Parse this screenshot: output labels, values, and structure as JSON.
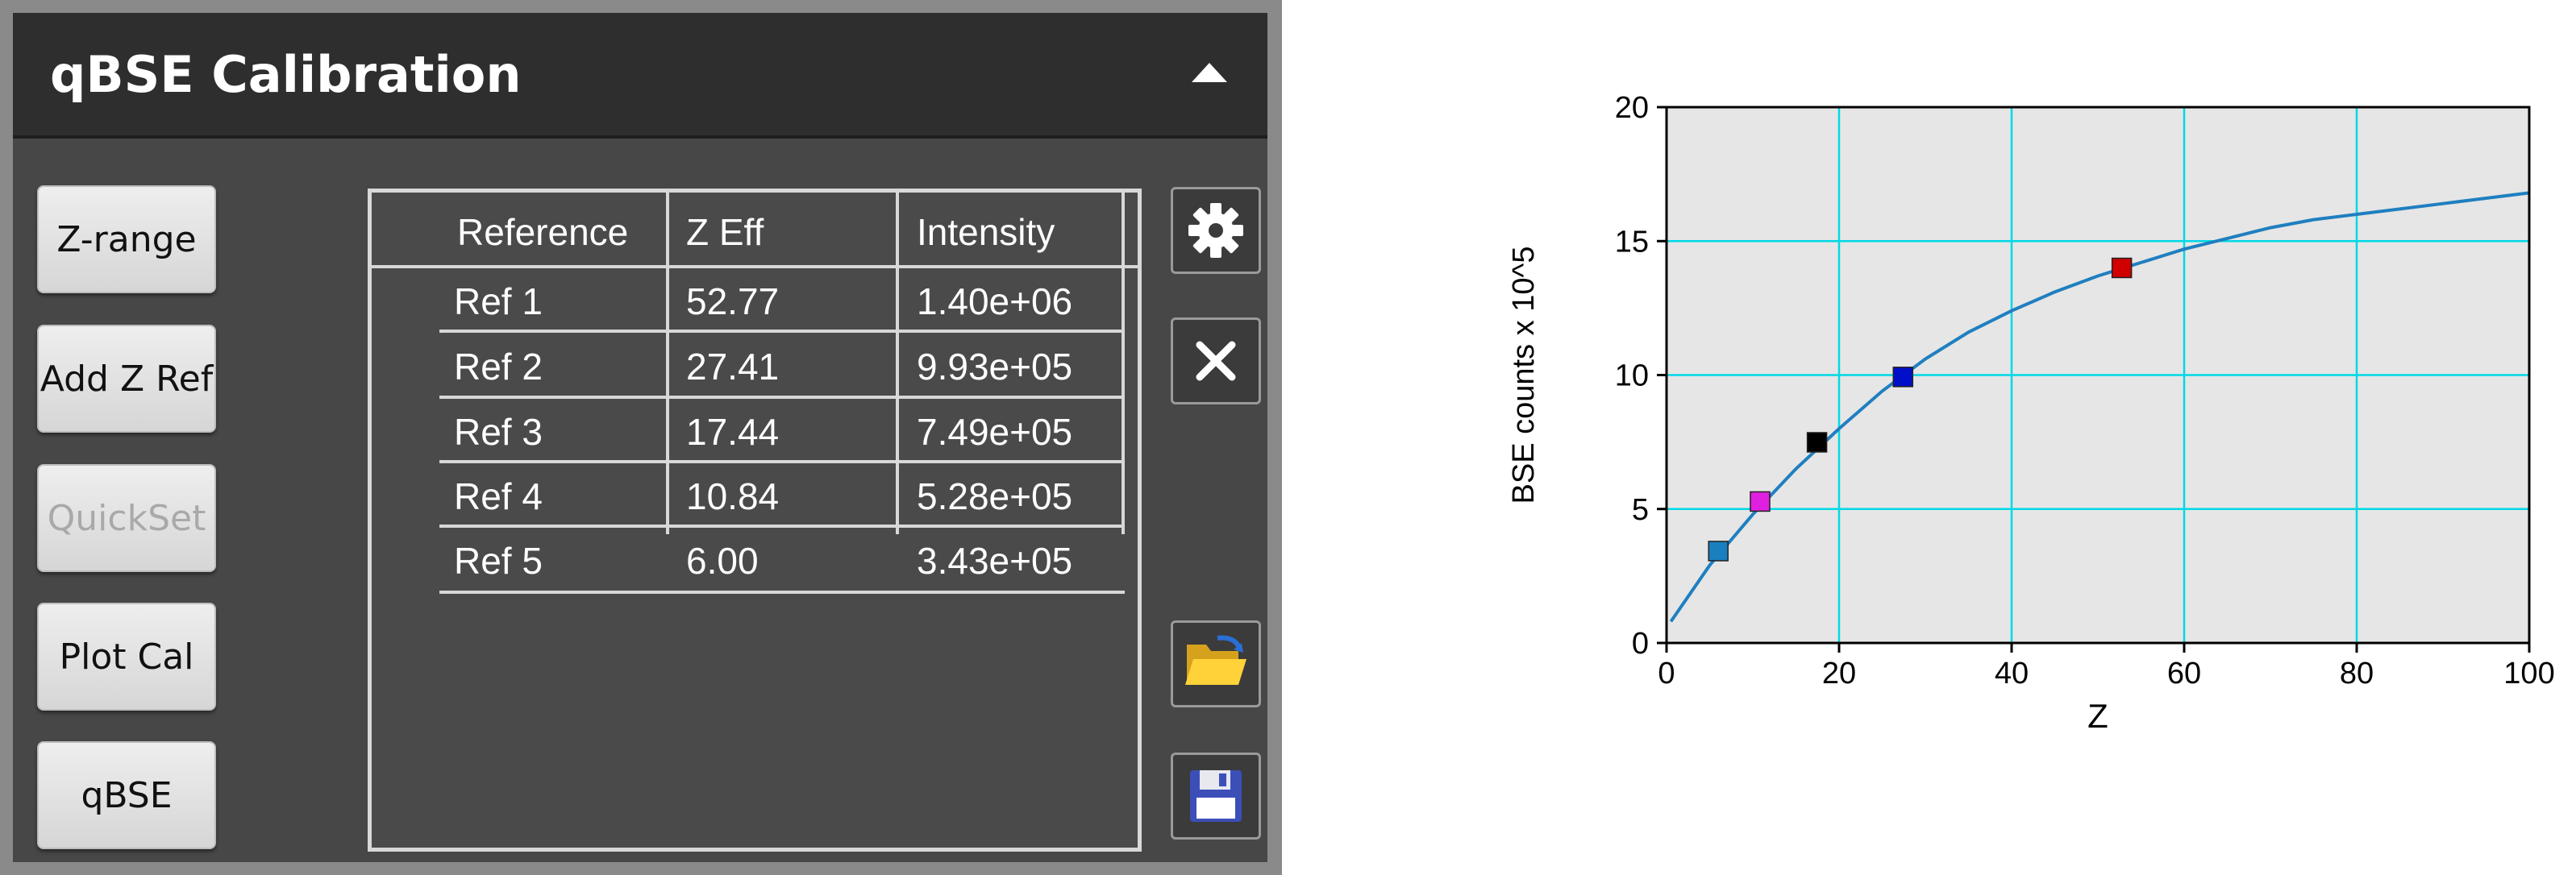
{
  "panel": {
    "title": "qBSE Calibration",
    "buttons": [
      {
        "label": "Z-range",
        "enabled": true
      },
      {
        "label": "Add Z Ref",
        "enabled": true
      },
      {
        "label": "QuickSet",
        "enabled": false
      },
      {
        "label": "Plot Cal",
        "enabled": true
      },
      {
        "label": "qBSE",
        "enabled": true
      }
    ],
    "table": {
      "headers": [
        "Reference",
        "Z Eff",
        "Intensity"
      ],
      "rows": [
        [
          "Ref 1",
          "52.77",
          "1.40e+06"
        ],
        [
          "Ref 2",
          "27.41",
          "9.93e+05"
        ],
        [
          "Ref 3",
          "17.44",
          "7.49e+05"
        ],
        [
          "Ref 4",
          "10.84",
          "5.28e+05"
        ],
        [
          "Ref 5",
          "6.00",
          "3.43e+05"
        ]
      ]
    },
    "icons": [
      "gear-icon",
      "close-icon",
      "open-folder-icon",
      "save-disk-icon"
    ]
  },
  "chart_data": {
    "type": "scatter",
    "xlabel": "Z",
    "ylabel": "BSE counts x 10^5",
    "xlim": [
      0,
      100
    ],
    "ylim": [
      0,
      20
    ],
    "xticks": [
      0,
      20,
      40,
      60,
      80,
      100
    ],
    "yticks": [
      0,
      5,
      10,
      15,
      20
    ],
    "grid": true,
    "background": "#e6e6e6",
    "grid_color": "#00d8e6",
    "curve_color": "#1f7fc0",
    "curve": {
      "x": [
        0.5,
        5,
        10,
        15,
        20,
        25,
        30,
        35,
        40,
        45,
        50,
        55,
        60,
        65,
        70,
        75,
        80,
        85,
        90,
        95,
        100
      ],
      "y": [
        0.8,
        2.9,
        4.8,
        6.5,
        8.0,
        9.4,
        10.6,
        11.6,
        12.4,
        13.1,
        13.7,
        14.2,
        14.7,
        15.1,
        15.5,
        15.8,
        16.0,
        16.2,
        16.4,
        16.6,
        16.8
      ]
    },
    "points": [
      {
        "x": 6.0,
        "y": 3.43,
        "color": "#1a7fbf"
      },
      {
        "x": 10.84,
        "y": 5.28,
        "color": "#e020e0"
      },
      {
        "x": 17.44,
        "y": 7.49,
        "color": "#000000"
      },
      {
        "x": 27.41,
        "y": 9.93,
        "color": "#0010c8"
      },
      {
        "x": 52.77,
        "y": 14.0,
        "color": "#d00000"
      }
    ]
  }
}
